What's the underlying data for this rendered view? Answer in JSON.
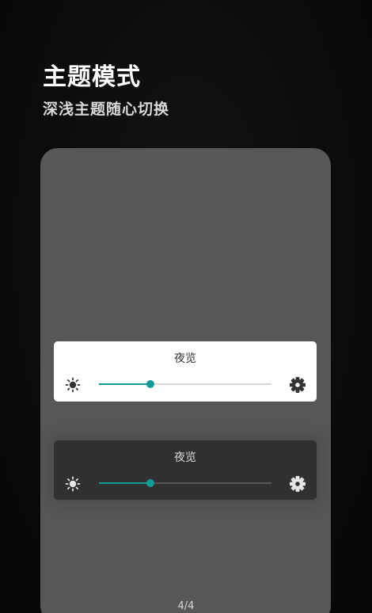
{
  "header": {
    "title": "主题模式",
    "subtitle": "深浅主题随心切换"
  },
  "cards": {
    "light": {
      "title": "夜览",
      "brightness_level": 0.3,
      "icons": [
        "sun-icon",
        "gear-icon"
      ]
    },
    "dark": {
      "title": "夜览",
      "brightness_level": 0.3,
      "icons": [
        "sun-icon",
        "gear-icon"
      ]
    }
  },
  "pager": {
    "indicator": "4/4"
  },
  "colors": {
    "accent": "#159a9a",
    "phone_background": "#575757",
    "light_card": "#ffffff",
    "dark_card": "#303030"
  }
}
